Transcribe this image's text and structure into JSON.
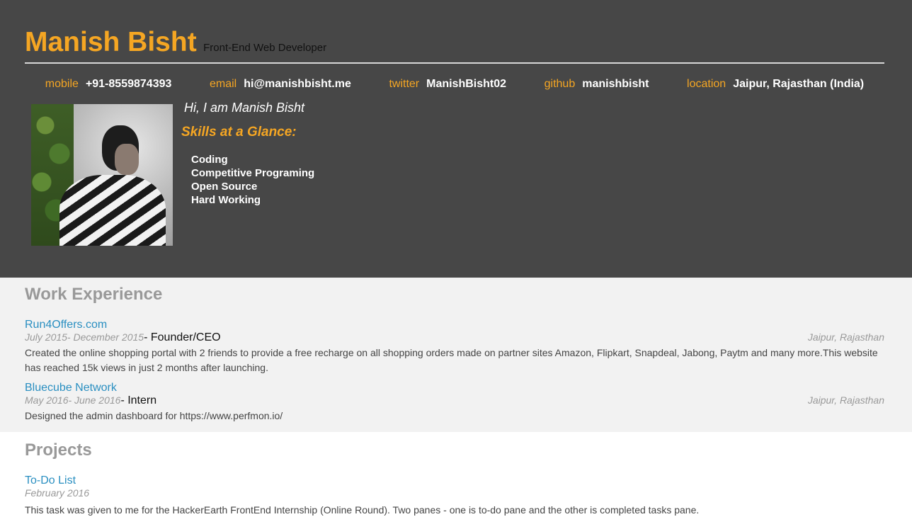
{
  "header": {
    "name": "Manish Bisht",
    "role": "Front-End Web Developer"
  },
  "contacts": [
    {
      "key": "mobile",
      "value": "+91-8559874393"
    },
    {
      "key": "email",
      "value": "hi@manishbisht.me"
    },
    {
      "key": "twitter",
      "value": "ManishBisht02"
    },
    {
      "key": "github",
      "value": "manishbisht"
    },
    {
      "key": "location",
      "value": "Jaipur, Rajasthan (India)"
    }
  ],
  "intro": {
    "greeting": "Hi, I am Manish Bisht",
    "skills_title": "Skills at a Glance:",
    "skills": [
      "Coding",
      "Competitive Programing",
      "Open Source",
      "Hard Working"
    ]
  },
  "work": {
    "title": "Work Experience",
    "entries": [
      {
        "company": "Run4Offers.com",
        "dates": "July 2015- December 2015",
        "position": "- Founder/CEO",
        "location": "Jaipur, Rajasthan",
        "description": "Created the online shopping portal with 2 friends to provide a free recharge on all shopping orders made on partner sites Amazon, Flipkart, Snapdeal, Jabong, Paytm and many more.This website has reached 15k views in just 2 months after launching."
      },
      {
        "company": "Bluecube Network",
        "dates": "May 2016- June 2016",
        "position": "- Intern",
        "location": "Jaipur, Rajasthan",
        "description": "Designed the admin dashboard for https://www.perfmon.io/"
      }
    ]
  },
  "projects": {
    "title": "Projects",
    "entries": [
      {
        "name": "To-Do List",
        "date": "February 2016",
        "description": "This task was given to me for the HackerEarth FrontEnd Internship (Online Round). Two panes - one is to-do pane and the other is completed tasks pane."
      }
    ]
  },
  "colors": {
    "header_bg": "#474747",
    "accent": "#f5a623",
    "link": "#2a8fc1",
    "work_bg": "#f2f2f2"
  }
}
